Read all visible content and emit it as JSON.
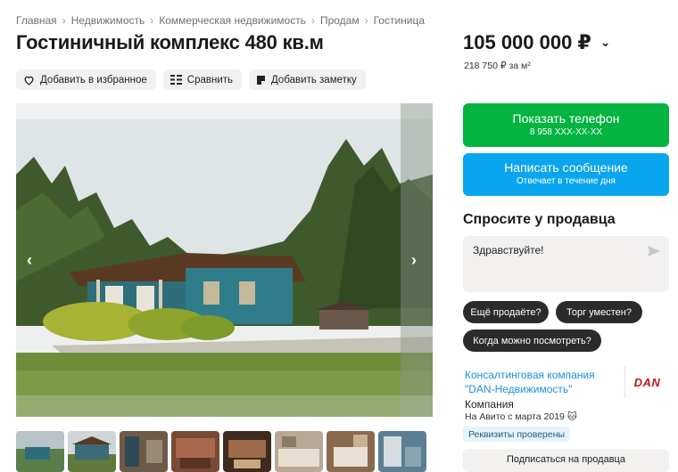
{
  "breadcrumbs": [
    "Главная",
    "Недвижимость",
    "Коммерческая недвижимость",
    "Продам",
    "Гостиница"
  ],
  "breadcrumb_separator": "›",
  "title": "Гостиничный комплекс 480 кв.м",
  "actions": {
    "favorite": "Добавить в избранное",
    "compare": "Сравнить",
    "note": "Добавить заметку"
  },
  "price": {
    "value": "105 000 000 ₽",
    "per_m2": "218 750 ₽ за м²"
  },
  "gallery": {
    "prev_icon": "chevron-left-icon",
    "next_icon": "chevron-right-icon",
    "thumb_count": 8
  },
  "contact": {
    "show_phone_label": "Показать телефон",
    "phone_masked": "8 958 XXX-XX-XX",
    "message_label": "Написать сообщение",
    "message_sub": "Отвечает в течение дня"
  },
  "ask_seller": {
    "heading": "Спросите у продавца",
    "message_value": "Здравствуйте!",
    "quick_questions": [
      "Ещё продаёте?",
      "Торг уместен?",
      "Когда можно посмотреть?"
    ]
  },
  "seller": {
    "name": "Консалтинговая компания \"DAN-Недвижимость\"",
    "type": "Компания",
    "since": "На Авито с марта 2019",
    "verified": "Реквизиты проверены",
    "logo_text": "DAN"
  },
  "subscribe_label": "Подписаться на продавца",
  "colors": {
    "green": "#04b340",
    "blue": "#0aa5ef",
    "link": "#1e8ede",
    "chip": "#2b2b2b"
  }
}
